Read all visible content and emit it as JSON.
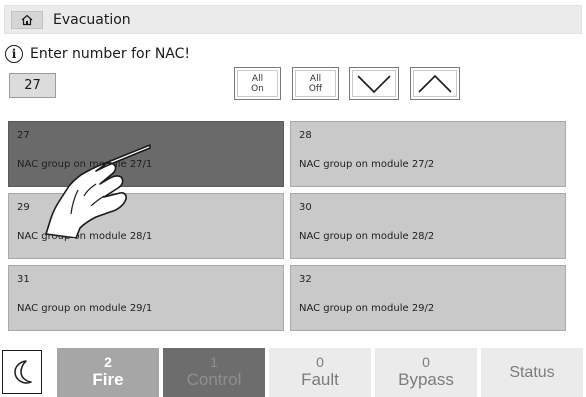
{
  "header": {
    "home_icon": "home-icon",
    "title": "Evacuation"
  },
  "hint": {
    "icon": "info-icon",
    "text": "Enter number for NAC!"
  },
  "number_input": {
    "value": "27"
  },
  "controls": {
    "all_on": {
      "line1": "All",
      "line2": "On"
    },
    "all_off": {
      "line1": "All",
      "line2": "Off"
    },
    "down_icon": "chevron-down-icon",
    "up_icon": "chevron-up-icon"
  },
  "tiles": [
    {
      "number": "27",
      "label": "NAC group on module 27/1",
      "selected": true
    },
    {
      "number": "28",
      "label": "NAC group on module 27/2",
      "selected": false
    },
    {
      "number": "29",
      "label": "NAC group on module 28/1",
      "selected": false
    },
    {
      "number": "30",
      "label": "NAC group on module 28/2",
      "selected": false
    },
    {
      "number": "31",
      "label": "NAC group on module 29/1",
      "selected": false
    },
    {
      "number": "32",
      "label": "NAC group on module 29/2",
      "selected": false
    }
  ],
  "overlay": {
    "icon": "pointing-hand-icon"
  },
  "status_bar": {
    "night_mode_icon": "moon-icon",
    "fire": {
      "count": "2",
      "label": "Fire"
    },
    "control": {
      "count": "1",
      "label": "Control"
    },
    "fault": {
      "count": "0",
      "label": "Fault"
    },
    "bypass": {
      "count": "0",
      "label": "Bypass"
    },
    "status": {
      "label": "Status"
    }
  },
  "colors": {
    "selected_tile": "#6a6a6a",
    "tile": "#c9c9c9",
    "fire_bg": "#a6a6a6",
    "control_bg": "#6d6d6d"
  }
}
